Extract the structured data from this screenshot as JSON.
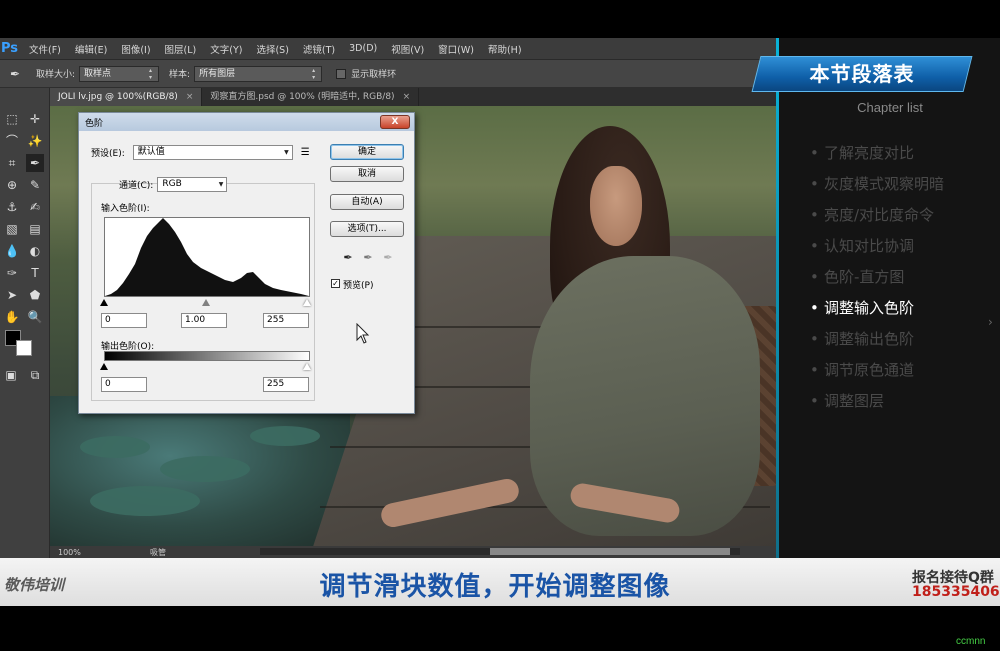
{
  "app": {
    "logo": "Ps"
  },
  "menu": [
    "文件(F)",
    "编辑(E)",
    "图像(I)",
    "图层(L)",
    "文字(Y)",
    "选择(S)",
    "滤镜(T)",
    "3D(D)",
    "视图(V)",
    "窗口(W)",
    "帮助(H)"
  ],
  "options": {
    "sample_size_label": "取样大小:",
    "sample_size_value": "取样点",
    "sample_label": "样本:",
    "sample_value": "所有图层",
    "show_ring_label": "显示取样环"
  },
  "tabs": [
    {
      "label": "JOLI lv.jpg @ 100%(RGB/8)",
      "active": true
    },
    {
      "label": "观察直方图.psd @ 100% (明暗适中, RGB/8)",
      "active": false
    }
  ],
  "status": {
    "zoom": "100%",
    "info": "吸管"
  },
  "levels_dialog": {
    "title": "色阶",
    "preset_label": "预设(E):",
    "preset_value": "默认值",
    "channel_label": "通道(C):",
    "channel_value": "RGB",
    "input_label": "输入色阶(I):",
    "input_black": "0",
    "input_gamma": "1.00",
    "input_white": "255",
    "output_label": "输出色阶(O):",
    "output_black": "0",
    "output_white": "255",
    "ok": "确定",
    "cancel": "取消",
    "auto": "自动(A)",
    "options": "选项(T)...",
    "preview_label": "预览(P)",
    "preview_checked": true,
    "close": "X"
  },
  "chapter": {
    "title": "本节段落表",
    "subtitle": "Chapter list",
    "items": [
      {
        "label": "了解亮度对比",
        "active": false
      },
      {
        "label": "灰度模式观察明暗",
        "active": false
      },
      {
        "label": "亮度/对比度命令",
        "active": false
      },
      {
        "label": "认知对比协调",
        "active": false
      },
      {
        "label": "色阶-直方图",
        "active": false
      },
      {
        "label": "调整输入色阶",
        "active": true
      },
      {
        "label": "调整输出色阶",
        "active": false
      },
      {
        "label": "调节原色通道",
        "active": false
      },
      {
        "label": "调整图层",
        "active": false
      }
    ]
  },
  "banner": {
    "brand": "敬伟培训",
    "caption": "调节滑块数值，开始调整图像",
    "contact_line1": "报名接待Q群",
    "contact_line2": "185335406"
  },
  "watermark": "ccmnn",
  "colors": {
    "accent_blue": "#1a54a6",
    "chapter_blue": "#0f5fa8",
    "contact_red": "#c0201a"
  }
}
